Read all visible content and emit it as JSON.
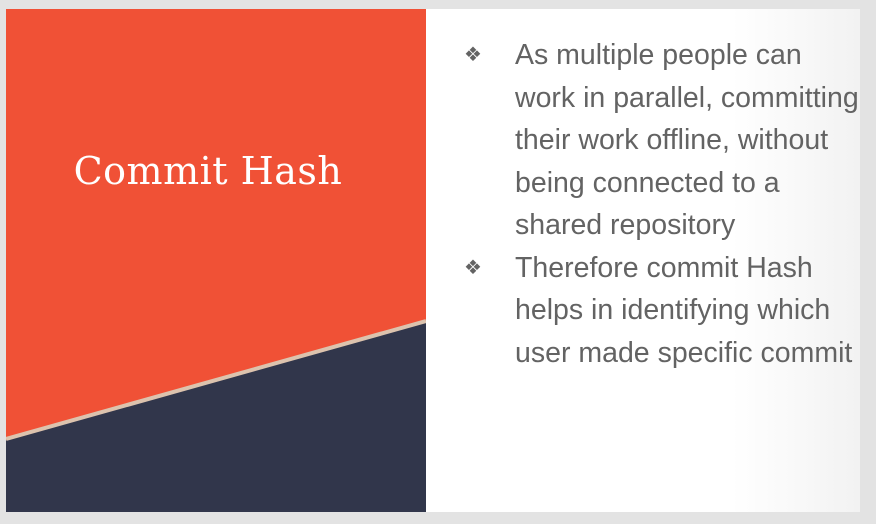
{
  "slide": {
    "title": "Commit Hash",
    "bullets": [
      {
        "icon": "diamond-bullet-icon",
        "text": "As multiple people can work in parallel, committing their work offline, without being connected to a shared repository"
      },
      {
        "icon": "diamond-bullet-icon",
        "text": "Therefore commit Hash helps in identifying which user made specific commit"
      }
    ],
    "bullet_glyph": "❖",
    "colors": {
      "accent": "#f05136",
      "dark": "#31364b",
      "stripe": "#dcc3ae",
      "text": "#636363"
    }
  }
}
